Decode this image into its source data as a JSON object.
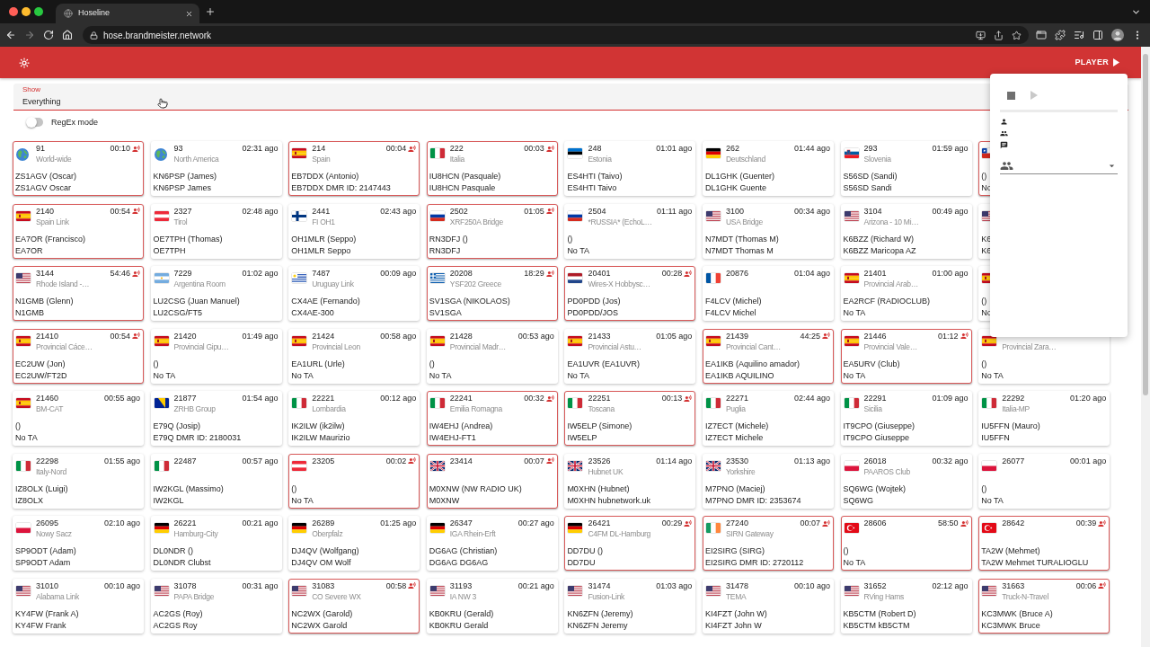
{
  "browser": {
    "tab_title": "Hoseline",
    "url": "hose.brandmeister.network"
  },
  "app_bar": {
    "player_button": "PLAYER"
  },
  "filter": {
    "label": "Show",
    "value": "Everything",
    "regex_toggle": {
      "label": "RegEx mode",
      "on": false
    }
  },
  "talkgroups": [
    {
      "talkgroup": "91",
      "name": "World-wide",
      "time": "00:10",
      "live": true,
      "kind": "world",
      "line_1": "ZS1AGV (Oscar)",
      "line_2": "ZS1AGV Oscar"
    },
    {
      "talkgroup": "93",
      "name": "North America",
      "time": "02:31 ago",
      "live": false,
      "kind": "world",
      "line_1": "KN6PSP (James)",
      "line_2": "KN6PSP James"
    },
    {
      "talkgroup": "214",
      "name": "Spain",
      "time": "00:04",
      "live": true,
      "kind": "spain",
      "line_1": "EB7DDX (Antonio)",
      "line_2": "EB7DDX DMR ID: 2147443"
    },
    {
      "talkgroup": "222",
      "name": "Italia",
      "time": "00:03",
      "live": true,
      "kind": "italy",
      "line_1": "IU8HCN (Pasquale)",
      "line_2": "IU8HCN Pasquale"
    },
    {
      "talkgroup": "248",
      "name": "Estonia",
      "time": "01:01 ago",
      "live": false,
      "kind": "estonia",
      "line_1": "ES4HTI (Taivo)",
      "line_2": "ES4HTI Taivo"
    },
    {
      "talkgroup": "262",
      "name": "Deutschland",
      "time": "01:44 ago",
      "live": false,
      "kind": "germany",
      "line_1": "DL1GHK (Guenter)",
      "line_2": "DL1GHK Guente"
    },
    {
      "talkgroup": "293",
      "name": "Slovenia",
      "time": "01:59 ago",
      "live": false,
      "kind": "slovenia",
      "line_1": "S56SD (Sandi)",
      "line_2": "S56SD Sandi"
    },
    {
      "live": true,
      "kind": "chile",
      "line_1": "()",
      "line_2": "No"
    },
    {
      "talkgroup": "2140",
      "name": "Spain Link",
      "time": "00:54",
      "live": true,
      "kind": "spain",
      "line_1": "EA7OR (Francisco)",
      "line_2": "EA7OR"
    },
    {
      "talkgroup": "2327",
      "name": "Tirol",
      "time": "02:48 ago",
      "live": false,
      "kind": "austria",
      "line_1": "OE7TPH (Thomas)",
      "line_2": "OE7TPH"
    },
    {
      "talkgroup": "2441",
      "name": "FI OH1",
      "time": "02:43 ago",
      "live": false,
      "kind": "finland",
      "line_1": "OH1MLR (Seppo)",
      "line_2": "OH1MLR Seppo"
    },
    {
      "talkgroup": "2502",
      "name": "XRF250A Bridge",
      "time": "01:05",
      "live": true,
      "kind": "russia",
      "line_1": "RN3DFJ ()",
      "line_2": "RN3DFJ"
    },
    {
      "talkgroup": "2504",
      "name": "*RUSSIA* (EchoL…",
      "time": "01:11 ago",
      "live": false,
      "kind": "russia",
      "line_1": "()",
      "line_2": "No TA"
    },
    {
      "talkgroup": "3100",
      "name": "USA Bridge",
      "time": "00:34 ago",
      "live": false,
      "kind": "usa",
      "line_1": "N7MDT (Thomas M)",
      "line_2": "N7MDT Thomas M"
    },
    {
      "talkgroup": "3104",
      "name": "Arizona - 10 Mi…",
      "time": "00:49 ago",
      "live": false,
      "kind": "usa",
      "line_1": "K6BZZ (Richard W)",
      "line_2": "K6BZZ Maricopa AZ"
    },
    {
      "live": false,
      "kind": "usa",
      "line_1": "K6",
      "line_2": "K6"
    },
    {
      "talkgroup": "3144",
      "name": "Rhode Island -…",
      "time": "54:46",
      "live": true,
      "kind": "usa",
      "line_1": "N1GMB (Glenn)",
      "line_2": "N1GMB"
    },
    {
      "talkgroup": "7229",
      "name": "Argentina Room",
      "time": "01:02 ago",
      "live": false,
      "kind": "argentina",
      "line_1": "LU2CSG (Juan Manuel)",
      "line_2": "LU2CSG/FT5"
    },
    {
      "talkgroup": "7487",
      "name": "Uruguay Link",
      "time": "00:09 ago",
      "live": false,
      "kind": "uruguay",
      "line_1": "CX4AE (Fernando)",
      "line_2": "CX4AE-300"
    },
    {
      "talkgroup": "20208",
      "name": "YSF202 Greece",
      "time": "18:29",
      "live": true,
      "kind": "greece",
      "line_1": "SV1SGA (NIKOLAOS)",
      "line_2": "SV1SGA"
    },
    {
      "talkgroup": "20401",
      "name": "Wires-X Hobbysc…",
      "time": "00:28",
      "live": true,
      "kind": "netherlands",
      "line_1": "PD0PDD (Jos)",
      "line_2": "PD0PDD/JOS"
    },
    {
      "talkgroup": "20876",
      "time": "01:04 ago",
      "live": false,
      "kind": "france",
      "line_1": "F4LCV (Michel)",
      "line_2": "F4LCV Michel"
    },
    {
      "talkgroup": "21401",
      "name": "Provincial Arab…",
      "time": "01:00 ago",
      "live": false,
      "kind": "spain",
      "line_1": "EA2RCF (RADIOCLUB)",
      "line_2": "No TA"
    },
    {
      "live": false,
      "kind": "spain",
      "line_1": "()",
      "line_2": "No"
    },
    {
      "talkgroup": "21410",
      "name": "Provincial Cáce…",
      "time": "00:54",
      "live": true,
      "kind": "spain",
      "line_1": "EC2UW (Jon)",
      "line_2": "EC2UW/FT2D"
    },
    {
      "talkgroup": "21420",
      "name": "Provincial Gipu…",
      "time": "01:49 ago",
      "live": false,
      "kind": "spain",
      "line_1": "()",
      "line_2": "No TA"
    },
    {
      "talkgroup": "21424",
      "name": "Provincial Leon",
      "time": "00:58 ago",
      "live": false,
      "kind": "spain",
      "line_1": "EA1URL (Urle)",
      "line_2": "No TA"
    },
    {
      "talkgroup": "21428",
      "name": "Provincial Madr…",
      "time": "00:53 ago",
      "live": false,
      "kind": "spain",
      "line_1": "()",
      "line_2": "No TA"
    },
    {
      "talkgroup": "21433",
      "name": "Provincial Astu…",
      "time": "01:05 ago",
      "live": false,
      "kind": "spain",
      "line_1": "EA1UVR (EA1UVR)",
      "line_2": "No TA"
    },
    {
      "talkgroup": "21439",
      "name": "Provincial Cant…",
      "time": "44:25",
      "live": true,
      "kind": "spain",
      "line_1": "EA1IKB (Aquilino amador)",
      "line_2": "EA1IKB AQUILINO"
    },
    {
      "talkgroup": "21446",
      "name": "Provincial Vale…",
      "time": "01:12",
      "live": true,
      "kind": "spain",
      "line_1": "EA5URV (Club)",
      "line_2": "No TA"
    },
    {
      "name": "Provincial Zara…",
      "live": false,
      "kind": "spain",
      "line_1": "()",
      "line_2": "No TA"
    },
    {
      "talkgroup": "21460",
      "name": "BM-CAT",
      "time": "00:55 ago",
      "live": false,
      "kind": "spain",
      "line_1": "()",
      "line_2": "No TA"
    },
    {
      "talkgroup": "21877",
      "name": "ZRHB Group",
      "time": "01:54 ago",
      "live": false,
      "kind": "bosnia",
      "line_1": "E79Q (Josip)",
      "line_2": "E79Q DMR ID: 2180031"
    },
    {
      "talkgroup": "22221",
      "name": "Lombardia",
      "time": "00:12 ago",
      "live": false,
      "kind": "italy",
      "line_1": "IK2ILW (ik2ilw)",
      "line_2": "IK2ILW Maurizio"
    },
    {
      "talkgroup": "22241",
      "name": "Emilia Romagna",
      "time": "00:32",
      "live": true,
      "kind": "italy",
      "line_1": "IW4EHJ (Andrea)",
      "line_2": "IW4EHJ-FT1"
    },
    {
      "talkgroup": "22251",
      "name": "Toscana",
      "time": "00:13",
      "live": true,
      "kind": "italy",
      "line_1": "IW5ELP (Simone)",
      "line_2": "IW5ELP"
    },
    {
      "talkgroup": "22271",
      "name": "Puglia",
      "time": "02:44 ago",
      "live": false,
      "kind": "italy",
      "line_1": "IZ7ECT (Michele)",
      "line_2": "IZ7ECT Michele"
    },
    {
      "talkgroup": "22291",
      "name": "Sicilia",
      "time": "01:09 ago",
      "live": false,
      "kind": "italy",
      "line_1": "IT9CPO (Giuseppe)",
      "line_2": "IT9CPO Giuseppe"
    },
    {
      "talkgroup": "22292",
      "name": "Italia-MP",
      "time": "01:20 ago",
      "live": false,
      "kind": "italy",
      "line_1": "IU5FFN (Mauro)",
      "line_2": "IU5FFN"
    },
    {
      "talkgroup": "22298",
      "name": "Italy-Nord",
      "time": "01:55 ago",
      "live": false,
      "kind": "italy",
      "line_1": "IZ8OLX (Luigi)",
      "line_2": "IZ8OLX"
    },
    {
      "talkgroup": "22487",
      "time": "00:57 ago",
      "live": false,
      "kind": "italy",
      "line_1": "IW2KGL (Massimo)",
      "line_2": "IW2KGL"
    },
    {
      "talkgroup": "23205",
      "time": "00:02",
      "live": true,
      "kind": "austria",
      "line_1": "()",
      "line_2": "No TA"
    },
    {
      "talkgroup": "23414",
      "time": "00:07",
      "live": true,
      "kind": "uk",
      "line_1": "M0XNW (NW RADIO UK)",
      "line_2": "M0XNW"
    },
    {
      "talkgroup": "23526",
      "name": "Hubnet UK",
      "time": "01:14 ago",
      "live": false,
      "kind": "uk",
      "line_1": "M0XHN (Hubnet)",
      "line_2": "M0XHN hubnetwork.uk"
    },
    {
      "talkgroup": "23530",
      "name": "Yorkshire",
      "time": "01:13 ago",
      "live": false,
      "kind": "uk",
      "line_1": "M7PNO (Maciej)",
      "line_2": "M7PNO DMR ID: 2353674"
    },
    {
      "talkgroup": "26018",
      "name": "PAAROS Club",
      "time": "00:32 ago",
      "live": false,
      "kind": "poland",
      "line_1": "SQ6WG (Wojtek)",
      "line_2": "SQ6WG"
    },
    {
      "talkgroup": "26077",
      "time": "00:01 ago",
      "live": false,
      "kind": "poland",
      "line_1": "()",
      "line_2": "No TA"
    },
    {
      "talkgroup": "26095",
      "name": "Nowy Sacz",
      "time": "02:10 ago",
      "live": false,
      "kind": "poland",
      "line_1": "SP9ODT (Adam)",
      "line_2": "SP9ODT Adam"
    },
    {
      "talkgroup": "26221",
      "name": "Hamburg-City",
      "time": "00:21 ago",
      "live": false,
      "kind": "germany",
      "line_1": "DL0NDR ()",
      "line_2": "DL0NDR Clubst"
    },
    {
      "talkgroup": "26289",
      "name": "Oberpfalz",
      "time": "01:25 ago",
      "live": false,
      "kind": "germany",
      "line_1": "DJ4QV (Wolfgang)",
      "line_2": "DJ4QV OM Wolf"
    },
    {
      "talkgroup": "26347",
      "name": "IGA Rhein-Erft",
      "time": "00:27 ago",
      "live": false,
      "kind": "germany",
      "line_1": "DG6AG (Christian)",
      "line_2": "DG6AG DG6AG"
    },
    {
      "talkgroup": "26421",
      "name": "C4FM DL-Hamburg",
      "time": "00:29",
      "live": true,
      "kind": "germany",
      "line_1": "DD7DU ()",
      "line_2": "DD7DU"
    },
    {
      "talkgroup": "27240",
      "name": "SIRN Gateway",
      "time": "00:07",
      "live": true,
      "kind": "ireland",
      "line_1": "EI2SIRG (SIRG)",
      "line_2": "EI2SIRG DMR ID: 2720112"
    },
    {
      "talkgroup": "28606",
      "time": "58:50",
      "live": true,
      "kind": "turkey",
      "line_1": "()",
      "line_2": "No TA"
    },
    {
      "talkgroup": "28642",
      "time": "00:39",
      "live": true,
      "kind": "turkey",
      "line_1": "TA2W (Mehmet)",
      "line_2": "TA2W Mehmet TURALIOGLU"
    },
    {
      "talkgroup": "31010",
      "name": "Alabama Link",
      "time": "00:10 ago",
      "live": false,
      "kind": "usa",
      "line_1": "KY4FW (Frank A)",
      "line_2": "KY4FW Frank"
    },
    {
      "talkgroup": "31078",
      "name": "PAPA Bridge",
      "time": "00:31 ago",
      "live": false,
      "kind": "usa",
      "line_1": "AC2GS (Roy)",
      "line_2": "AC2GS Roy"
    },
    {
      "talkgroup": "31083",
      "name": "CO Severe WX",
      "time": "00:58",
      "live": true,
      "kind": "usa",
      "line_1": "NC2WX (Garold)",
      "line_2": "NC2WX Garold"
    },
    {
      "talkgroup": "31193",
      "name": "IA NW 3",
      "time": "00:21 ago",
      "live": false,
      "kind": "usa",
      "line_1": "KB0KRU (Gerald)",
      "line_2": "KB0KRU Gerald"
    },
    {
      "talkgroup": "31474",
      "name": "Fusion-Link",
      "time": "01:03 ago",
      "live": false,
      "kind": "usa",
      "line_1": "KN6ZFN (Jeremy)",
      "line_2": "KN6ZFN Jeremy"
    },
    {
      "talkgroup": "31478",
      "name": "TEMA",
      "time": "00:10 ago",
      "live": false,
      "kind": "usa",
      "line_1": "KI4FZT (John W)",
      "line_2": "KI4FZT John W"
    },
    {
      "talkgroup": "31652",
      "name": "RVing Hams",
      "time": "02:12 ago",
      "live": false,
      "kind": "usa",
      "line_1": "KB5CTM (Robert D)",
      "line_2": "KB5CTM kB5CTM"
    },
    {
      "talkgroup": "31663",
      "name": "Truck-N-Travel",
      "time": "00:06",
      "live": true,
      "kind": "usa",
      "line_1": "KC3MWK (Bruce A)",
      "line_2": "KC3MWK Bruce"
    }
  ],
  "player": {
    "controls": [
      {
        "kind": "stop",
        "disabled": false
      },
      {
        "kind": "play",
        "disabled": true
      }
    ]
  }
}
